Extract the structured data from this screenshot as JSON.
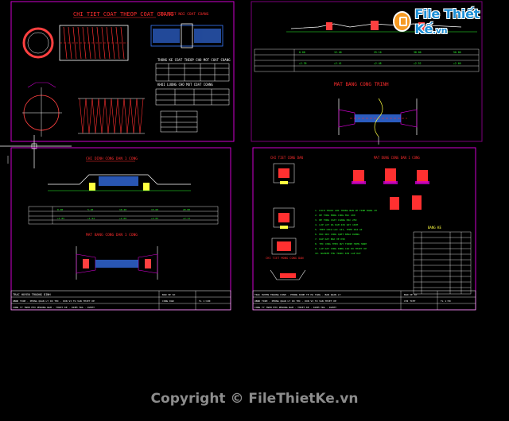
{
  "watermark": {
    "brand": "File Thiết Kế",
    "tld": ".vn",
    "copyright": "Copyright © FileThietKe.vn"
  },
  "sheet1": {
    "title": "CHI TIET COAT THEOP COAT COANG",
    "subtitle": "CHI TIET NOI COAT COANG",
    "table1_caption": "THONG KE COAT THEOP CHO MOT COAT COANG",
    "table2_caption": "KHOI LUONG CHO MOT COAT COANG"
  },
  "sheet2": {
    "caption": "MAT BANG CONG TRINH"
  },
  "sheet3": {
    "title": "CHI DINH CONG DAN 1 CONG",
    "plan_caption": "MAT BANG CONG DAN 1 CONG",
    "notes": "TRAC HUYEN TRUONG DINH"
  },
  "sheet4": {
    "caption_main": "CHI TIET CONG DAN",
    "caption_right": "MAT DUNG CONG DAN 1 CONG",
    "table_caption": "BANG KE",
    "detail_caption": "CHI TIET MONG CONG DAN"
  },
  "colors": {
    "background": "#000000",
    "sheet_border": "#d000d0",
    "lines": "#ffffff",
    "labels": "#ff2d2d",
    "text_green": "#2dff2d",
    "accent_blue": "#3a7bff",
    "accent_yellow": "#ffff40"
  }
}
